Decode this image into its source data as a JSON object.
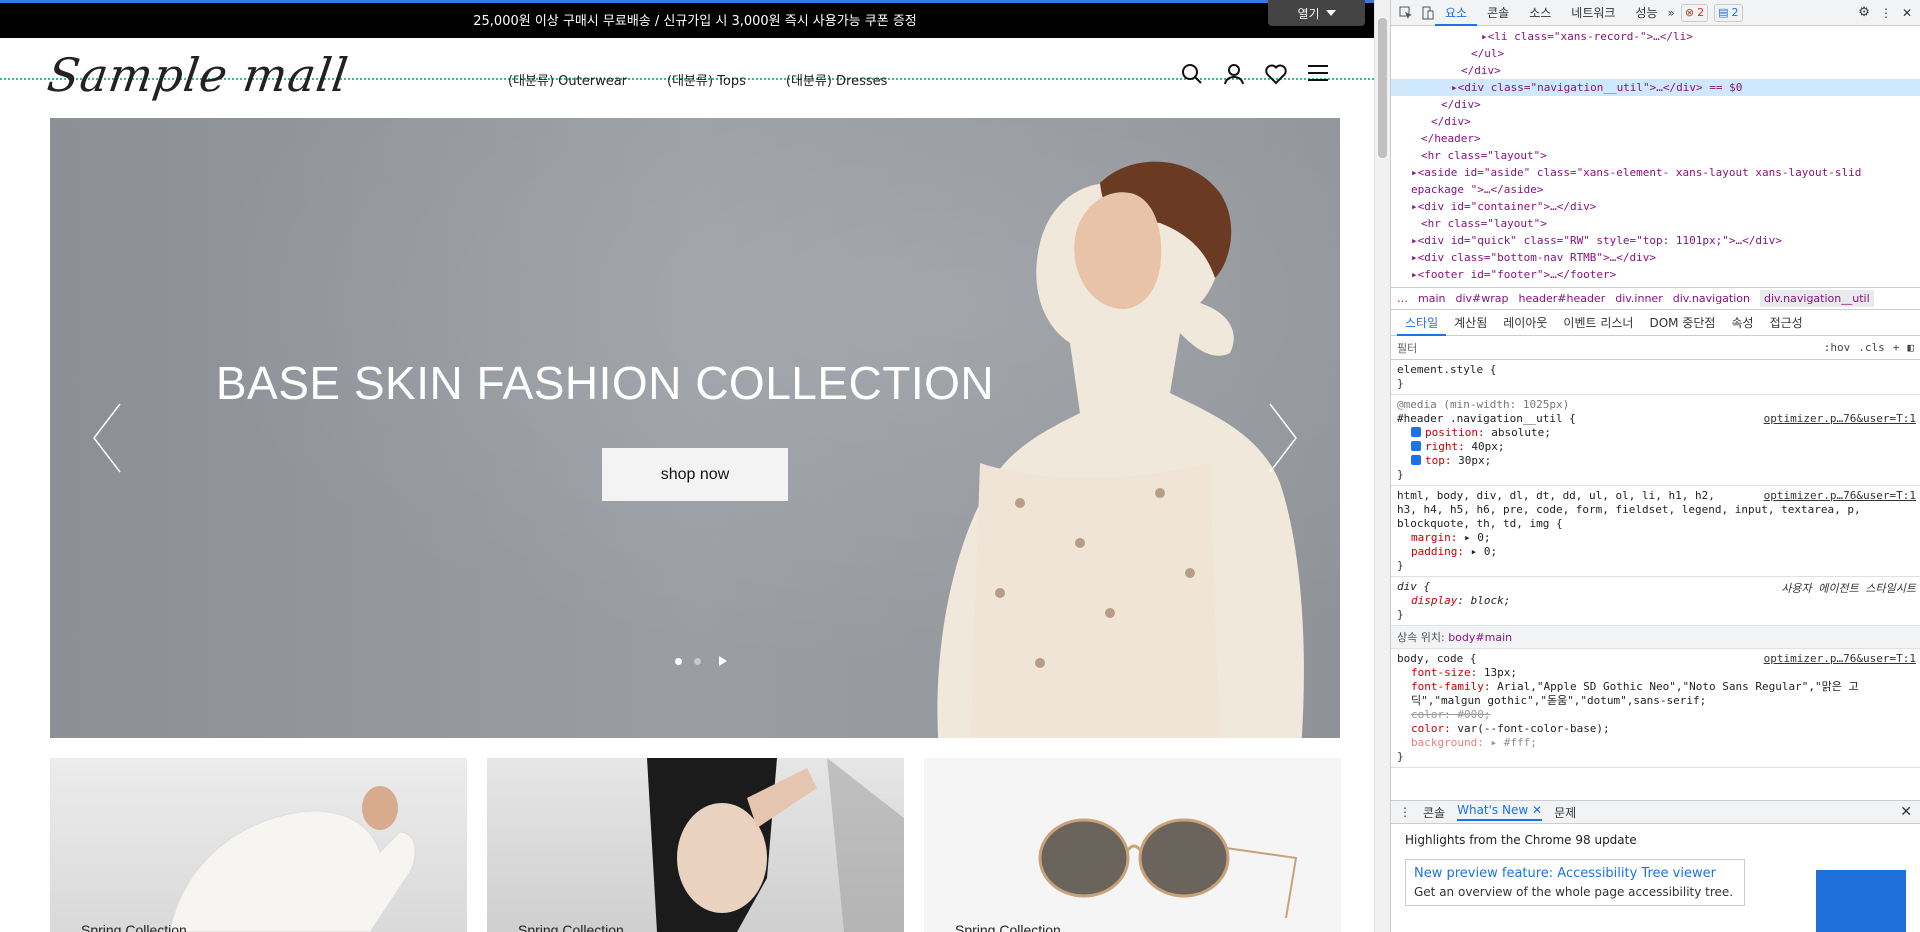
{
  "site": {
    "promo": "25,000원 이상 구매시 무료배송 / 신규가입 시 3,000원 즉시 사용가능 쿠폰 증정",
    "open_button": "열기",
    "logo": "Sample mall",
    "nav": [
      "(대분류) Outerwear",
      "(대분류) Tops",
      "(대분류) Dresses"
    ],
    "hero": {
      "title": "BASE SKIN FASHION COLLECTION",
      "button": "shop now",
      "slide_count": 2,
      "active_slide": 1
    },
    "cards": [
      "Spring Collection",
      "Spring Collection",
      "Spring Collection"
    ]
  },
  "devtools": {
    "tabs": [
      "요소",
      "콘솔",
      "소스",
      "네트워크",
      "성능"
    ],
    "error_count": "2",
    "message_count": "2",
    "breadcrumbs": [
      "main",
      "div#wrap",
      "header#header",
      "div.inner",
      "div.navigation",
      "div.navigation__util"
    ],
    "sub_tabs": [
      "스타일",
      "계산됨",
      "레이아웃",
      "이벤트 리스너",
      "DOM 중단점",
      "속성",
      "접근성"
    ],
    "filter_placeholder": "필터",
    "filter_buttons": [
      ":hov",
      ".cls",
      "+"
    ],
    "dom_lines": [
      {
        "indent": 9,
        "text": "▸<li class=\"xans-record-\">…</li>"
      },
      {
        "indent": 8,
        "text": "</ul>"
      },
      {
        "indent": 7,
        "text": "</div>"
      },
      {
        "indent": 6,
        "text": "▸<div class=\"navigation__util\">…</div> == $0"
      },
      {
        "indent": 5,
        "text": "</div>"
      },
      {
        "indent": 4,
        "text": "</div>"
      },
      {
        "indent": 3,
        "text": "</header>"
      },
      {
        "indent": 3,
        "text": "<hr class=\"layout\">"
      },
      {
        "indent": 2,
        "text": "▸<aside id=\"aside\" class=\"xans-element- xans-layout xans-layout-slid"
      },
      {
        "indent": 2,
        "text": "epackage \">…</aside>"
      },
      {
        "indent": 2,
        "text": "▸<div id=\"container\">…</div>"
      },
      {
        "indent": 3,
        "text": "<hr class=\"layout\">"
      },
      {
        "indent": 2,
        "text": "▸<div id=\"quick\" class=\"RW\" style=\"top: 1101px;\">…</div>"
      },
      {
        "indent": 2,
        "text": "▸<div class=\"bottom-nav RTMB\">…</div>"
      },
      {
        "indent": 2,
        "text": "▸<footer id=\"footer\">…</footer>"
      }
    ],
    "styles": {
      "element_style": "element.style {",
      "media": "@media (min-width: 1025px)",
      "rule1_selector": "#header .navigation__util {",
      "rule1_src": "optimizer.p…76&user=T:1",
      "rule1_props": [
        {
          "name": "position",
          "value": "absolute;"
        },
        {
          "name": "right",
          "value": "40px;"
        },
        {
          "name": "top",
          "value": "30px;"
        }
      ],
      "rule2_selector": "html, body, div, dl, dt, dd, ul, ol, li, h1, h2,",
      "rule2_selector2": "h3, h4, h5, h6, pre, code, form, fieldset, legend, input, textarea, p,",
      "rule2_selector3": "blockquote, th, td, img {",
      "rule2_src": "optimizer.p…76&user=T:1",
      "rule2_props": [
        {
          "name": "margin",
          "value": "▸ 0;"
        },
        {
          "name": "padding",
          "value": "▸ 0;"
        }
      ],
      "rule3_selector": "div {",
      "rule3_src": "사용자 에이전트 스타일시트",
      "rule3_prop": {
        "name": "display",
        "value": "block;"
      },
      "inherit_label": "상속 위치:",
      "inherit_target": "body#main",
      "rule4_selector": "body, code {",
      "rule4_src": "optimizer.p…76&user=T:1",
      "rule4_props": [
        {
          "name": "font-size",
          "value": "13px;"
        },
        {
          "name": "font-family",
          "value": "Arial,\"Apple SD Gothic Neo\",\"Noto Sans Regular\",\"맑은 고"
        },
        {
          "name": "",
          "value": "딕\",\"malgun gothic\",\"돋움\",\"dotum\",sans-serif;"
        },
        {
          "name": "color",
          "value": "#000;"
        },
        {
          "name": "color",
          "value": "var(--font-color-base);"
        },
        {
          "name": "background",
          "value": "▸ #fff;"
        }
      ]
    },
    "drawer_tabs": [
      "콘솔",
      "What's New",
      "문제"
    ],
    "whatsnew_head": "Highlights from the Chrome 98 update",
    "whatsnew_card_title": "New preview feature: Accessibility Tree viewer",
    "whatsnew_card_desc": "Get an overview of the whole page accessibility tree."
  }
}
